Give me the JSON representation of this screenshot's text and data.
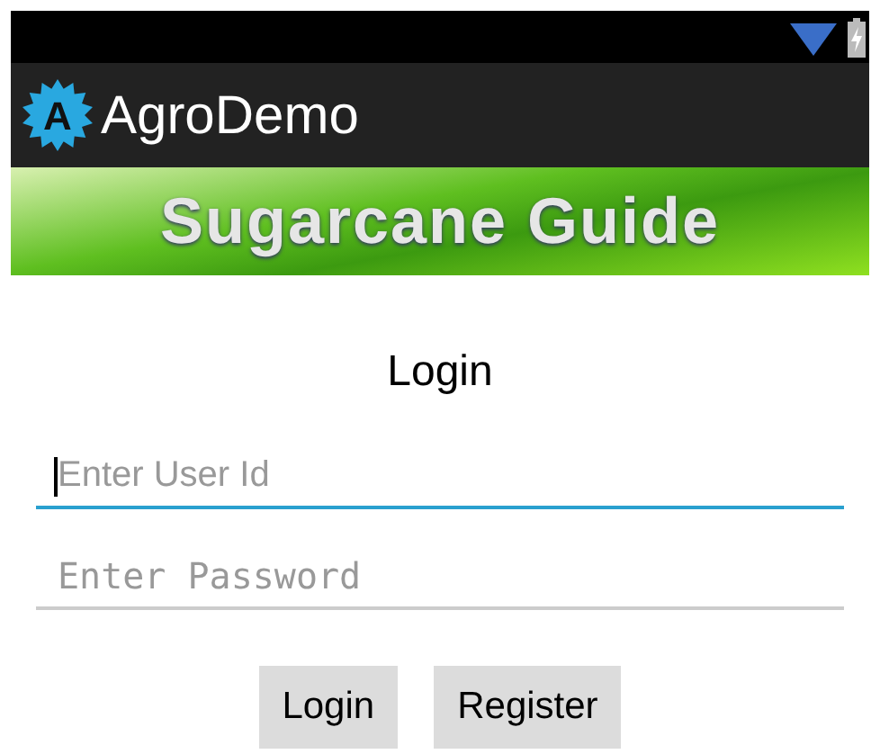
{
  "app_bar": {
    "title": "AgroDemo",
    "logo_letter": "A"
  },
  "banner": {
    "title": "Sugarcane Guide"
  },
  "form": {
    "title": "Login",
    "fields": [
      {
        "kind": "text",
        "placeholder": "Enter User Id",
        "focused": true
      },
      {
        "kind": "password",
        "placeholder": "Enter Password",
        "focused": false
      }
    ],
    "buttons": [
      "Login",
      "Register"
    ]
  }
}
